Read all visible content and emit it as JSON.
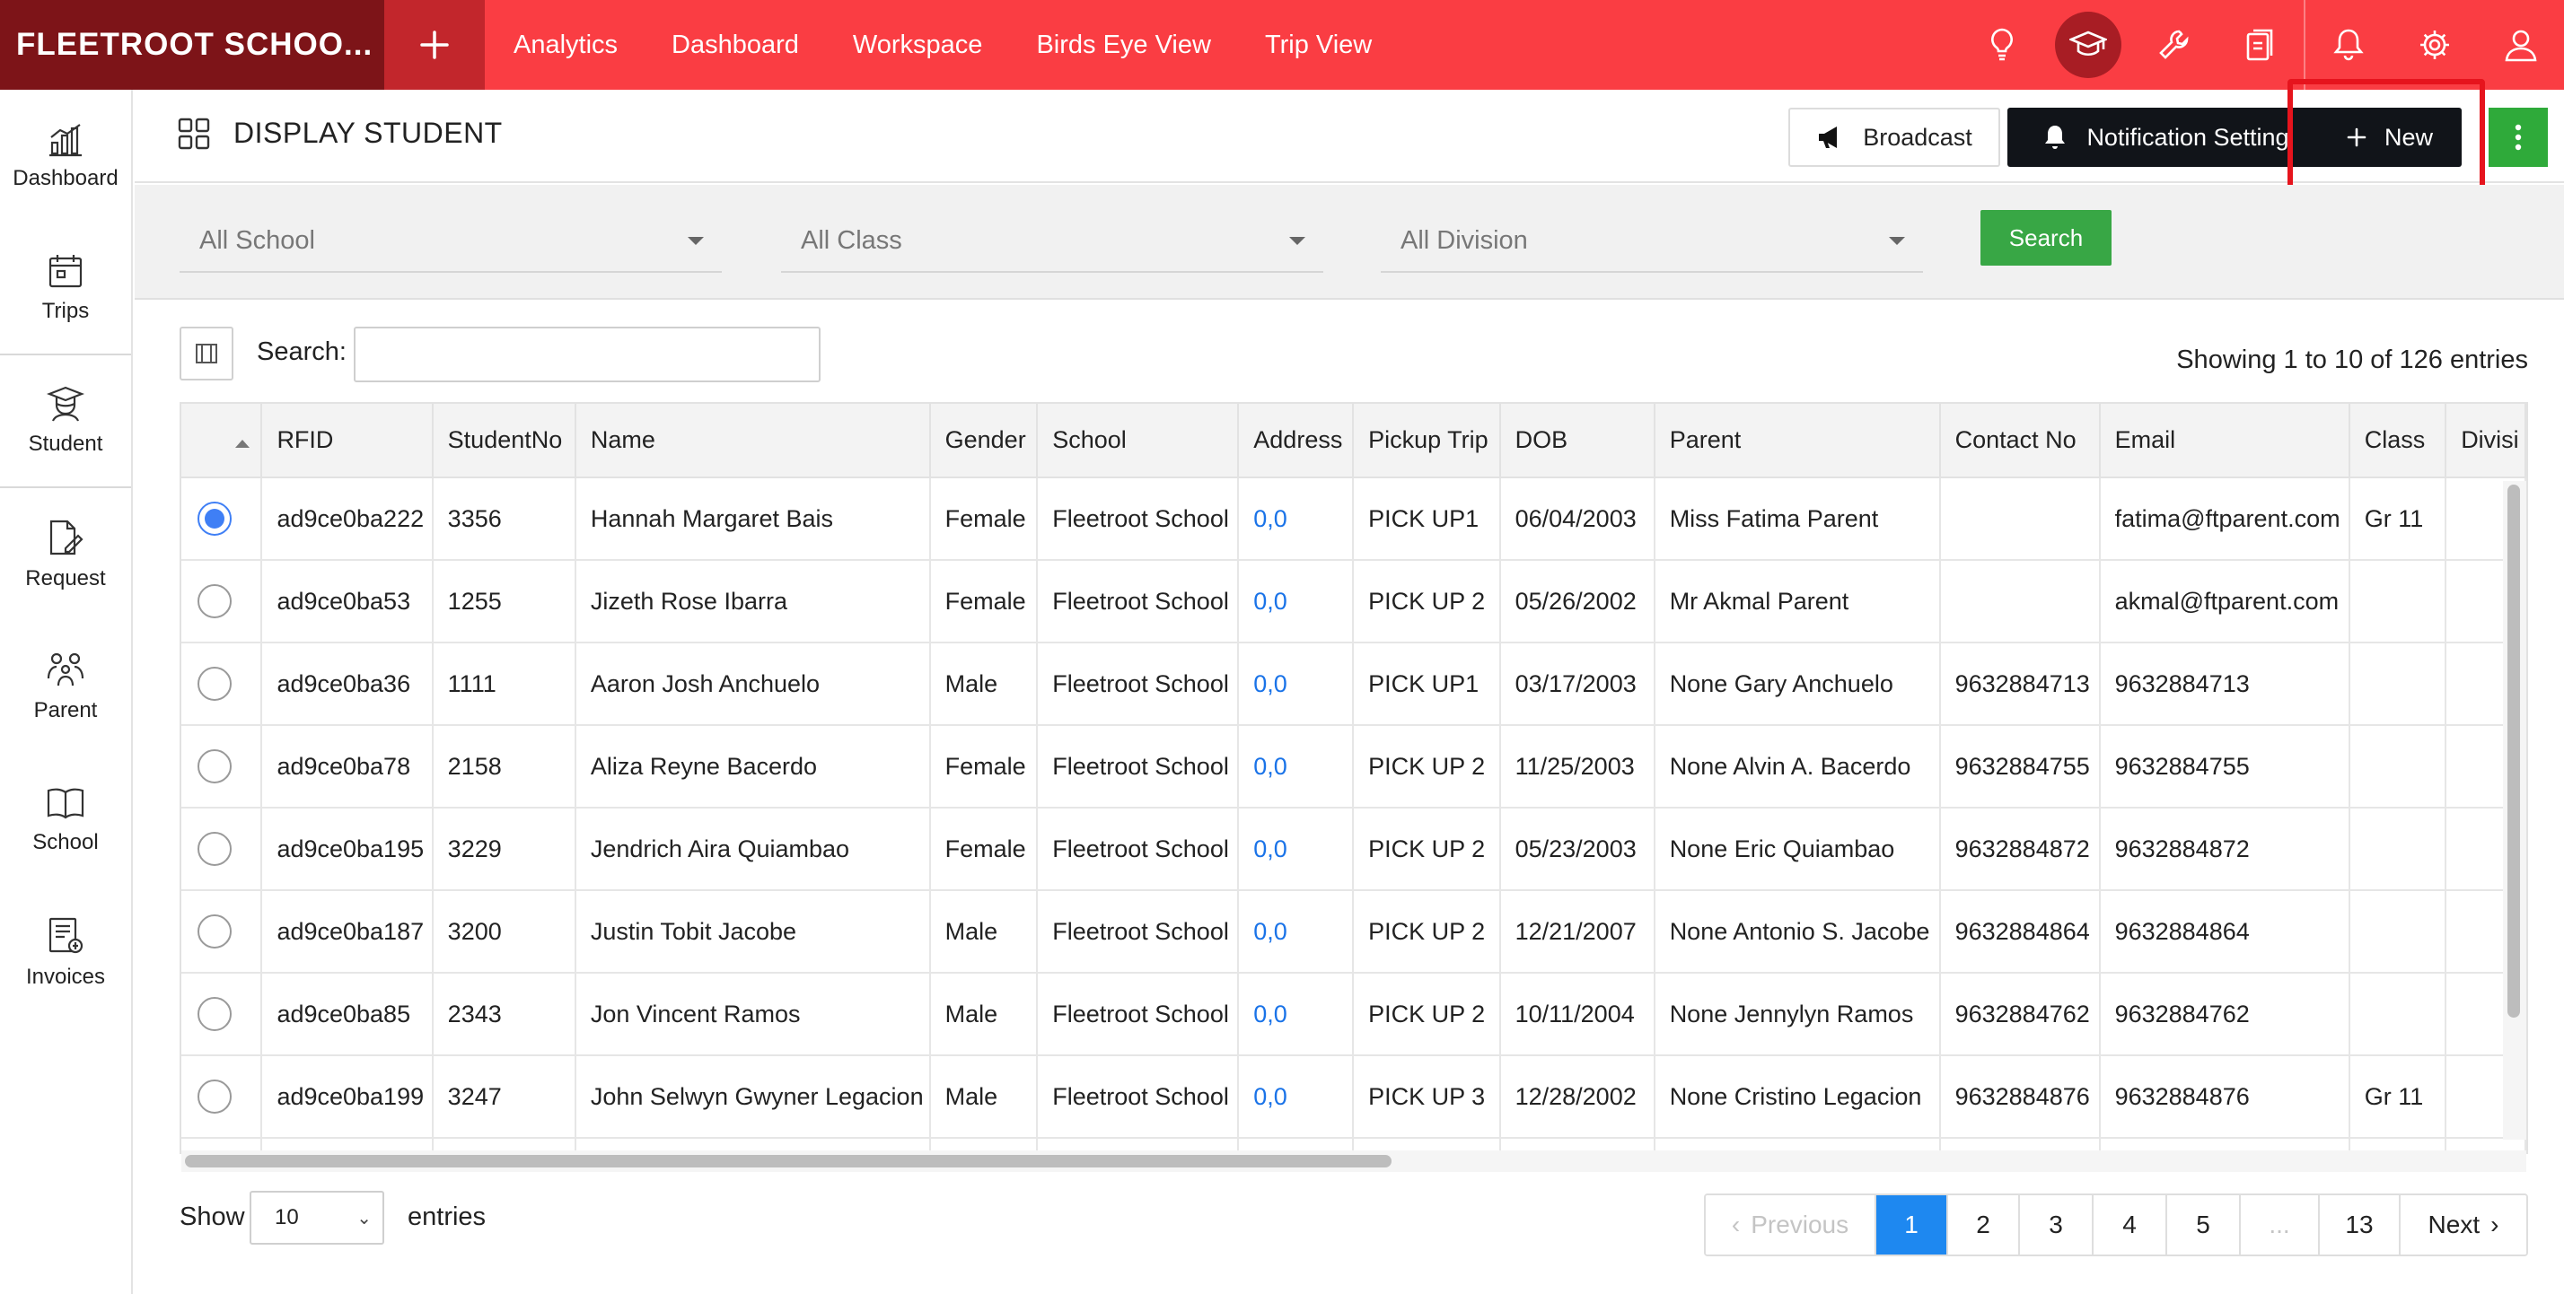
{
  "topbar": {
    "brand": "FLEETROOT SCHOO...",
    "add_icon": "plus-icon",
    "nav": [
      "Analytics",
      "Dashboard",
      "Workspace",
      "Birds Eye View",
      "Trip View"
    ],
    "icons": [
      "lightbulb-icon",
      "graduation-cap-icon",
      "wrench-icon",
      "clipboard-icon",
      "bell-icon",
      "gear-icon",
      "user-icon"
    ],
    "colors": {
      "bar": "#fa3d43",
      "brand_bg": "#7d1418",
      "active_icon_bg": "#a81d24"
    }
  },
  "sidebar": {
    "items": [
      {
        "label": "Dashboard",
        "icon": "bar-chart-icon"
      },
      {
        "label": "Trips",
        "icon": "calendar-icon"
      },
      {
        "label": "Student",
        "icon": "student-icon"
      },
      {
        "label": "Request",
        "icon": "document-edit-icon"
      },
      {
        "label": "Parent",
        "icon": "family-icon"
      },
      {
        "label": "School",
        "icon": "book-icon"
      },
      {
        "label": "Invoices",
        "icon": "invoice-icon"
      }
    ]
  },
  "header": {
    "title": "DISPLAY STUDENT",
    "broadcast_label": "Broadcast",
    "notification_label": "Notification Setting",
    "new_label": "New"
  },
  "filters": {
    "school": "All School",
    "class": "All Class",
    "division": "All Division",
    "search_button": "Search"
  },
  "table": {
    "search_label": "Search:",
    "search_value": "",
    "showing": "Showing 1 to 10 of 126 entries",
    "columns": [
      "",
      "RFID",
      "StudentNo",
      "Name",
      "Gender",
      "School",
      "Address",
      "Pickup Trip",
      "DOB",
      "Parent",
      "Contact No",
      "Email",
      "Class",
      "Divisi"
    ],
    "rows": [
      {
        "selected": true,
        "rfid": "ad9ce0ba222",
        "no": "3356",
        "name": "Hannah Margaret Bais",
        "gender": "Female",
        "school": "Fleetroot School",
        "address": "0,0",
        "trip": "PICK UP1",
        "dob": "06/04/2003",
        "parent": "Miss Fatima Parent",
        "contact": "",
        "email": "fatima@ftparent.com",
        "class": "Gr 11"
      },
      {
        "selected": false,
        "rfid": "ad9ce0ba53",
        "no": "1255",
        "name": "Jizeth Rose Ibarra",
        "gender": "Female",
        "school": "Fleetroot School",
        "address": "0,0",
        "trip": "PICK UP 2",
        "dob": "05/26/2002",
        "parent": "Mr Akmal Parent",
        "contact": "",
        "email": "akmal@ftparent.com",
        "class": ""
      },
      {
        "selected": false,
        "rfid": "ad9ce0ba36",
        "no": "1111",
        "name": "Aaron Josh Anchuelo",
        "gender": "Male",
        "school": "Fleetroot School",
        "address": "0,0",
        "trip": "PICK UP1",
        "dob": "03/17/2003",
        "parent": "None Gary Anchuelo",
        "contact": "9632884713",
        "email": "9632884713",
        "class": ""
      },
      {
        "selected": false,
        "rfid": "ad9ce0ba78",
        "no": "2158",
        "name": "Aliza Reyne Bacerdo",
        "gender": "Female",
        "school": "Fleetroot School",
        "address": "0,0",
        "trip": "PICK UP 2",
        "dob": "11/25/2003",
        "parent": "None Alvin A. Bacerdo",
        "contact": "9632884755",
        "email": "9632884755",
        "class": ""
      },
      {
        "selected": false,
        "rfid": "ad9ce0ba195",
        "no": "3229",
        "name": "Jendrich Aira Quiambao",
        "gender": "Female",
        "school": "Fleetroot School",
        "address": "0,0",
        "trip": "PICK UP 2",
        "dob": "05/23/2003",
        "parent": "None Eric Quiambao",
        "contact": "9632884872",
        "email": "9632884872",
        "class": ""
      },
      {
        "selected": false,
        "rfid": "ad9ce0ba187",
        "no": "3200",
        "name": "Justin Tobit Jacobe",
        "gender": "Male",
        "school": "Fleetroot School",
        "address": "0,0",
        "trip": "PICK UP 2",
        "dob": "12/21/2007",
        "parent": "None Antonio S. Jacobe",
        "contact": "9632884864",
        "email": "9632884864",
        "class": ""
      },
      {
        "selected": false,
        "rfid": "ad9ce0ba85",
        "no": "2343",
        "name": "Jon Vincent Ramos",
        "gender": "Male",
        "school": "Fleetroot School",
        "address": "0,0",
        "trip": "PICK UP 2",
        "dob": "10/11/2004",
        "parent": "None Jennylyn Ramos",
        "contact": "9632884762",
        "email": "9632884762",
        "class": ""
      },
      {
        "selected": false,
        "rfid": "ad9ce0ba199",
        "no": "3247",
        "name": "John Selwyn Gwyner Legacion",
        "gender": "Male",
        "school": "Fleetroot School",
        "address": "0,0",
        "trip": "PICK UP 3",
        "dob": "12/28/2002",
        "parent": "None Cristino Legacion",
        "contact": "9632884876",
        "email": "9632884876",
        "class": "Gr 11"
      }
    ]
  },
  "footer": {
    "show_label": "Show",
    "page_size": "10",
    "entries_label": "entries",
    "pages": [
      "Previous",
      "1",
      "2",
      "3",
      "4",
      "5",
      "...",
      "13",
      "Next"
    ],
    "active_page": "1"
  }
}
